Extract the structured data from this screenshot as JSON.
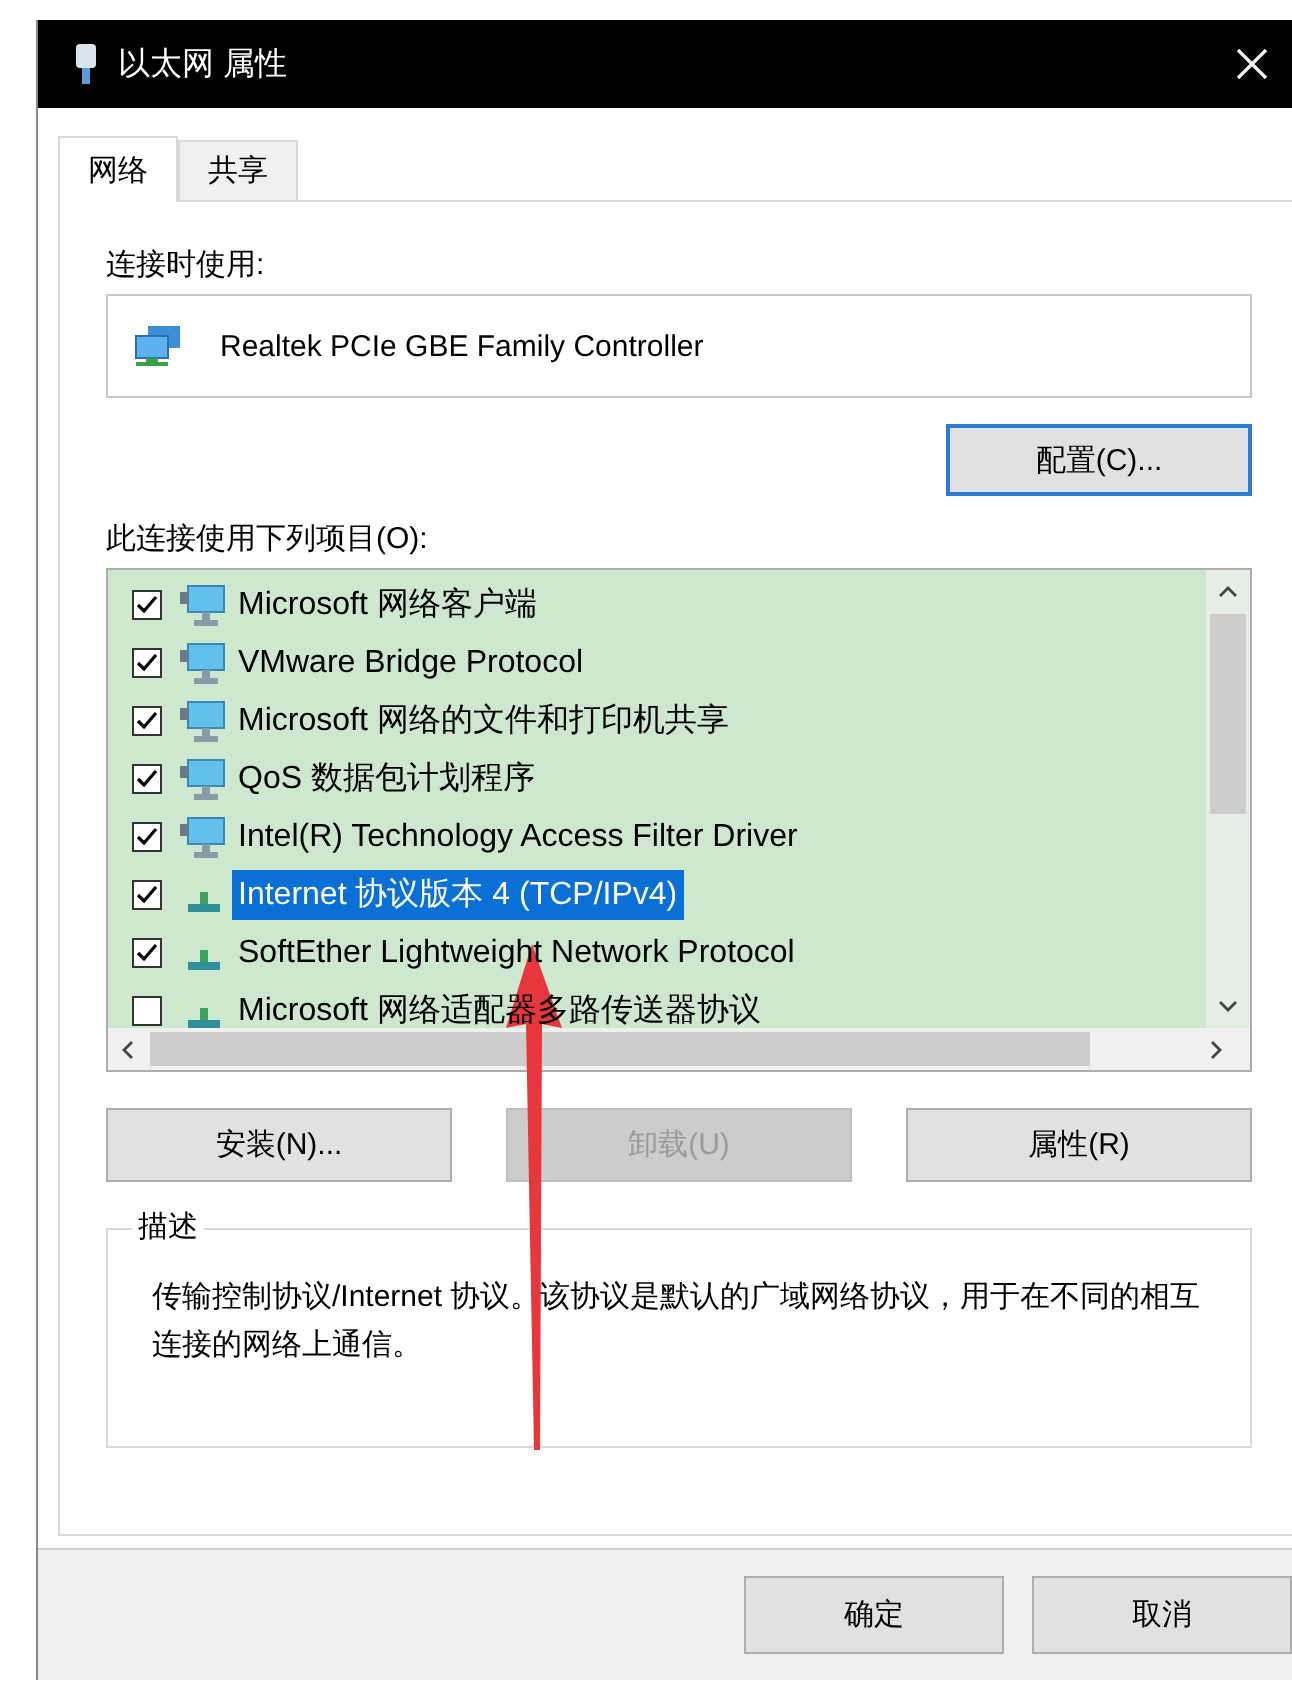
{
  "window": {
    "title": "以太网 属性"
  },
  "tabs": [
    {
      "label": "网络",
      "selected": true
    },
    {
      "label": "共享",
      "selected": false
    }
  ],
  "connect_using": {
    "label": "连接时使用:",
    "adapter": "Realtek PCIe GBE Family Controller",
    "configure_button": "配置(C)..."
  },
  "items_label": "此连接使用下列项目(O):",
  "items": [
    {
      "label": "Microsoft 网络客户端",
      "kind": "service",
      "checked": true,
      "selected": false
    },
    {
      "label": "VMware Bridge Protocol",
      "kind": "service",
      "checked": true,
      "selected": false
    },
    {
      "label": "Microsoft 网络的文件和打印机共享",
      "kind": "service",
      "checked": true,
      "selected": false
    },
    {
      "label": "QoS 数据包计划程序",
      "kind": "service",
      "checked": true,
      "selected": false
    },
    {
      "label": "Intel(R) Technology Access Filter Driver",
      "kind": "service",
      "checked": true,
      "selected": false
    },
    {
      "label": "Internet 协议版本 4 (TCP/IPv4)",
      "kind": "protocol",
      "checked": true,
      "selected": true
    },
    {
      "label": "SoftEther Lightweight Network Protocol",
      "kind": "protocol",
      "checked": true,
      "selected": false
    },
    {
      "label": "Microsoft 网络适配器多路传送器协议",
      "kind": "protocol",
      "checked": false,
      "selected": false
    }
  ],
  "buttons": [
    {
      "label": "安装(N)...",
      "disabled": false
    },
    {
      "label": "卸载(U)",
      "disabled": true
    },
    {
      "label": "属性(R)",
      "disabled": false
    }
  ],
  "description": {
    "title": "描述",
    "text": "传输控制协议/Internet 协议。该协议是默认的广域网络协议，用于在不同的相互连接的网络上通信。"
  },
  "dialog_buttons": [
    "确定",
    "取消"
  ]
}
